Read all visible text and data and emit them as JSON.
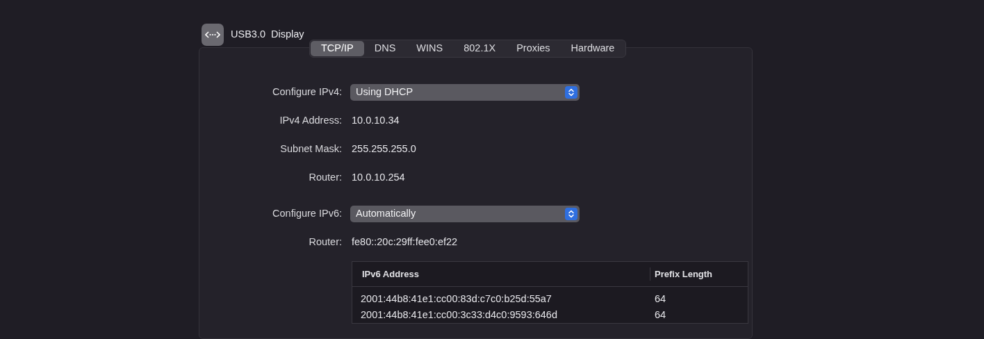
{
  "header": {
    "title": "USB3.0  Display"
  },
  "tabs": [
    {
      "label": "TCP/IP",
      "selected": true
    },
    {
      "label": "DNS",
      "selected": false
    },
    {
      "label": "WINS",
      "selected": false
    },
    {
      "label": "802.1X",
      "selected": false
    },
    {
      "label": "Proxies",
      "selected": false
    },
    {
      "label": "Hardware",
      "selected": false
    }
  ],
  "fields": [
    {
      "kind": "popup",
      "label": "Configure IPv4:",
      "value": "Using DHCP"
    },
    {
      "kind": "value",
      "label": "IPv4 Address:",
      "value": "10.0.10.34"
    },
    {
      "kind": "value",
      "label": "Subnet Mask:",
      "value": "255.255.255.0"
    },
    {
      "kind": "value",
      "label": "Router:",
      "value": "10.0.10.254"
    },
    {
      "kind": "popup",
      "label": "Configure IPv6:",
      "value": "Automatically"
    },
    {
      "kind": "value",
      "label": "Router:",
      "value": "fe80::20c:29ff:fee0:ef22"
    }
  ],
  "table": {
    "columns": [
      "IPv6 Address",
      "Prefix Length"
    ],
    "rows": [
      [
        "2001:44b8:41e1:cc00:83d:c7c0:b25d:55a7",
        "64"
      ],
      [
        "2001:44b8:41e1:cc00:3c33:d4c0:9593:646d",
        "64"
      ]
    ]
  }
}
